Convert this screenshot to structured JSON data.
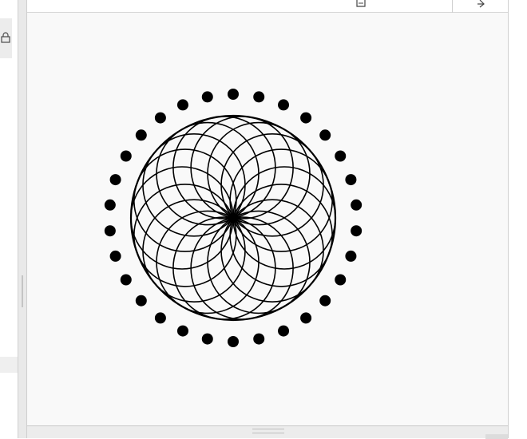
{
  "ui": {
    "icons": {
      "left_panel": "lock-icon",
      "toolbar_left": "save-icon",
      "toolbar_right": "export-icon"
    }
  },
  "plot": {
    "background": "#f9f9f9",
    "ink": "#000000",
    "spirograph": {
      "ring_count": 18,
      "dot_count": 30
    }
  }
}
